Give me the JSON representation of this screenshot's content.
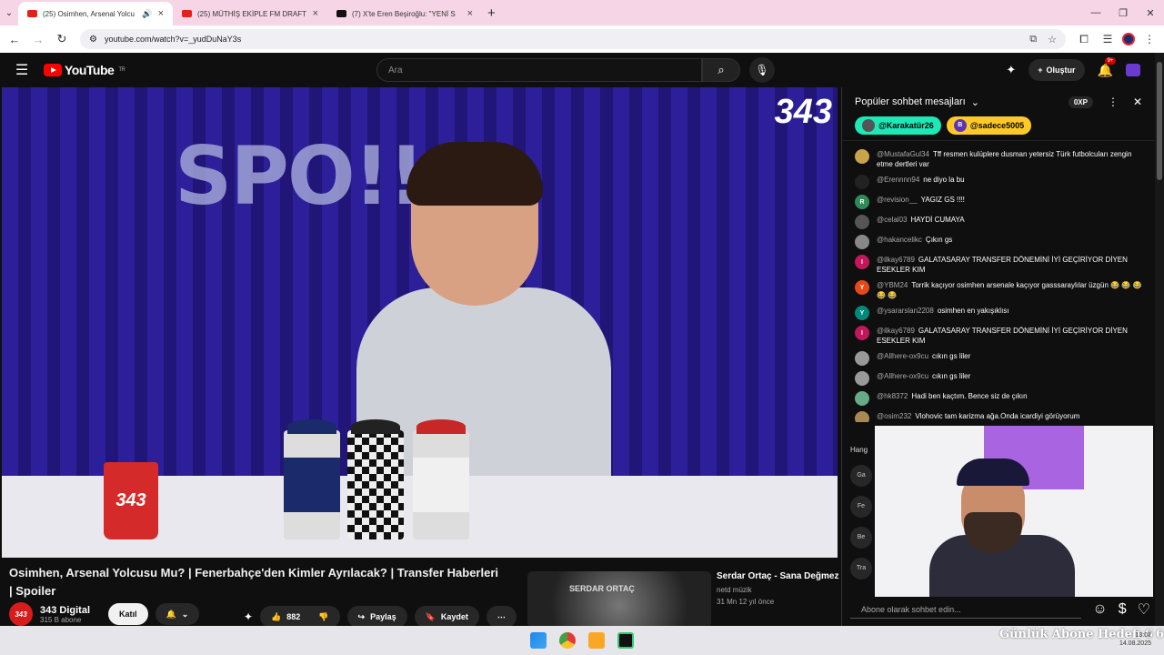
{
  "browser": {
    "tabs": [
      {
        "title": "(25) Osimhen, Arsenal Yolcu",
        "active": true,
        "favicon": "youtube-icon"
      },
      {
        "title": "(25) MÜTHİŞ EKİPLE FM DRAFT",
        "active": false,
        "favicon": "youtube-icon"
      },
      {
        "title": "(7) X'te Eren Beşiroğlu: \"YENİ S",
        "active": false,
        "favicon": "x-icon"
      }
    ],
    "url": "youtube.com/watch?v=_yudDuNaY3s"
  },
  "youtube": {
    "region": "TR",
    "search_placeholder": "Ara",
    "create_label": "Oluştur",
    "notif_count": "9+"
  },
  "video": {
    "title": "Osimhen, Arsenal Yolcusu Mu? | Fenerbahçe'den Kimler Ayrılacak? | Transfer Haberleri | Spoiler",
    "watermark": "343",
    "mug_text": "343",
    "channel_name": "343 Digital",
    "channel_avatar": "343",
    "channel_subs": "315 B abone",
    "join_label": "Katıl",
    "likes": "882",
    "share_label": "Paylaş",
    "save_label": "Kaydet"
  },
  "recommended": {
    "title": "Serdar Ortaç - Sana Değmez",
    "channel": "netd müzik",
    "meta": "31 Mn  12 yıl önce",
    "thumb_text": "SERDAR ORTAÇ"
  },
  "chat": {
    "header": "Popüler sohbet mesajları",
    "xp": "0XP",
    "pinned": [
      "@Karakatür26",
      "@sadece5005"
    ],
    "pinned_avatar": "B",
    "messages": [
      {
        "author": "@MustafaGul34",
        "text": "Tff resmen kulüplere dusman yetersiz Türk futbolcuları zengin etme dertleri var",
        "avatar": "",
        "color": "#c9a44a"
      },
      {
        "author": "@Erennnn94",
        "text": "ne diyo la bu",
        "avatar": "",
        "color": "#222"
      },
      {
        "author": "@revision__",
        "text": "YAGIZ GS !!!!",
        "avatar": "R",
        "color": "#2e8b57"
      },
      {
        "author": "@celal03",
        "text": "HAYDİ CUMAYA",
        "avatar": "",
        "color": "#555"
      },
      {
        "author": "@hakancelikc",
        "text": "Çıkın gs",
        "avatar": "",
        "color": "#888"
      },
      {
        "author": "@ilkay6789",
        "text": "GALATASARAY TRANSFER DÖNEMİNİ İYİ GEÇİRİYOR DİYEN ESEKLER KIM",
        "avatar": "I",
        "color": "#c2185b"
      },
      {
        "author": "@YBM24",
        "text": "Torrik kaçıyor osimhen arsenale kaçıyor gasssaraylılar üzgün 😂 😂 😂 😂 😂",
        "avatar": "Y",
        "color": "#e64a19"
      },
      {
        "author": "@ysararslan2208",
        "text": "osimhen en yakışıklısı",
        "avatar": "Y",
        "color": "#00897b"
      },
      {
        "author": "@ilkay6789",
        "text": "GALATASARAY TRANSFER DÖNEMİNİ İYİ GEÇİRİYOR DİYEN ESEKLER KIM",
        "avatar": "I",
        "color": "#c2185b"
      },
      {
        "author": "@Allhere-ox9cu",
        "text": "cıkın gs liler",
        "avatar": "",
        "color": "#999"
      },
      {
        "author": "@Allhere-ox9cu",
        "text": "cıkın gs liler",
        "avatar": "",
        "color": "#999"
      },
      {
        "author": "@hk8372",
        "text": "Hadi ben kaçtım. Bence siz de çıkın",
        "avatar": "",
        "color": "#6a8"
      },
      {
        "author": "@osim232",
        "text": "Vlohovic tam karizma ağa.Onda icardiyi görüyorum",
        "avatar": "",
        "color": "#a85"
      }
    ],
    "overlay_label": "Hang",
    "side_buttons": [
      "Ga",
      "Fe",
      "Be",
      "Tra"
    ],
    "input_placeholder": "Abone olarak sohbet edin..."
  },
  "overlay": {
    "ticker": "Günlük Abone Hedefi 6",
    "ticker_value": "6"
  },
  "taskbar": {
    "time": "13:02",
    "date": "14.08.2025"
  }
}
